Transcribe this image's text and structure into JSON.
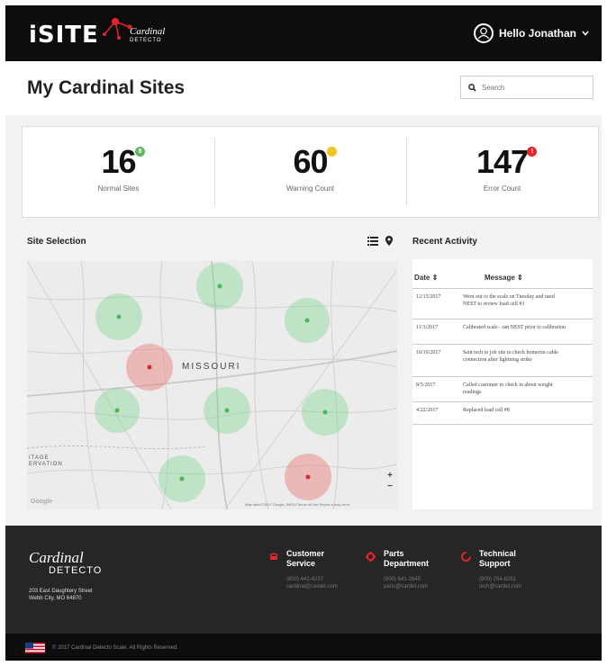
{
  "header": {
    "logo_text": "iSITE",
    "brand_name": "Cardinal",
    "brand_sub": "DETECTO",
    "greeting": "Hello Jonathan"
  },
  "page": {
    "title": "My Cardinal Sites",
    "search_placeholder": "Search"
  },
  "stats": [
    {
      "value": "16",
      "label": "Normal Sites",
      "badge": "8",
      "color": "#5cb85c"
    },
    {
      "value": "60",
      "label": "Warning Count",
      "badge": "",
      "color": "#f0c419"
    },
    {
      "value": "147",
      "label": "Error Count",
      "badge": "!",
      "color": "#e5252a"
    }
  ],
  "site_selection": {
    "title": "Site Selection",
    "map_label_state": "MISSOURI",
    "map_label_side": "ITAGE\nERVATION",
    "zoom_in": "+",
    "zoom_out": "−",
    "google": "Google",
    "attribution": "Map data ©2017 Google, INEGI    Terms of Use    Report a map error"
  },
  "recent_activity": {
    "title": "Recent Activity",
    "col_date": "Date ⇕",
    "col_message": "Message ⇕",
    "rows": [
      {
        "date": "12/15/2017",
        "message": "Went out to the scale on Tuesday and used NEST to review load cell #3"
      },
      {
        "date": "11/3/2017",
        "message": "Calibrated scale - ran NEST prior to calibration"
      },
      {
        "date": "10/19/2017",
        "message": "Sent tech to job site to check homerun cable connection after lightning strike"
      },
      {
        "date": "8/5/2017",
        "message": "Called customer to check in about weight readings"
      },
      {
        "date": "4/22/2017",
        "message": "Replaced load cell #8"
      }
    ]
  },
  "footer": {
    "brand_name": "Cardinal",
    "brand_sub": "DETECTO",
    "address_line1": "203 East Daughtery Street",
    "address_line2": "Webb City, MO 64870",
    "columns": [
      {
        "title_1": "Customer",
        "title_2": "Service",
        "phone": "(800) 441-4237",
        "email": "cardinal@cardet.com",
        "icon_color": "#e5252a"
      },
      {
        "title_1": "Parts",
        "title_2": "Department",
        "phone": "(800) 641-2645",
        "email": "parts@cardet.com",
        "icon_color": "#e5252a"
      },
      {
        "title_1": "Technical",
        "title_2": "Support",
        "phone": "(800) 254-8261",
        "email": "tech@cardet.com",
        "icon_color": "#e5252a"
      }
    ],
    "copyright": "© 2017 Cardinal Detecto Scale. All Rights Reserved."
  }
}
